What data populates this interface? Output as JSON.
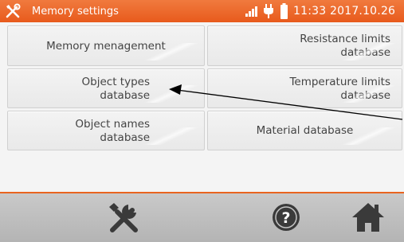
{
  "statusbar": {
    "title": "Memory settings",
    "datetime": "11:33 2017.10.26",
    "icons": [
      "tools-icon",
      "signal-icon",
      "plug-icon",
      "battery-icon"
    ]
  },
  "menu": {
    "memory_management": "Memory menagement",
    "resistance_limits": [
      "Resistance limits",
      "database"
    ],
    "object_types": [
      "Object types",
      "database"
    ],
    "temperature_limits": [
      "Temperature limits",
      "database"
    ],
    "object_names": [
      "Object names",
      "database"
    ],
    "material_database": "Material database"
  },
  "toolbar": {
    "icons": [
      "tools-icon",
      "help-icon",
      "home-icon"
    ]
  },
  "colors": {
    "accent": "#e8641f",
    "button_bg": "#efefef",
    "toolbar_bg": "#bebebe"
  }
}
